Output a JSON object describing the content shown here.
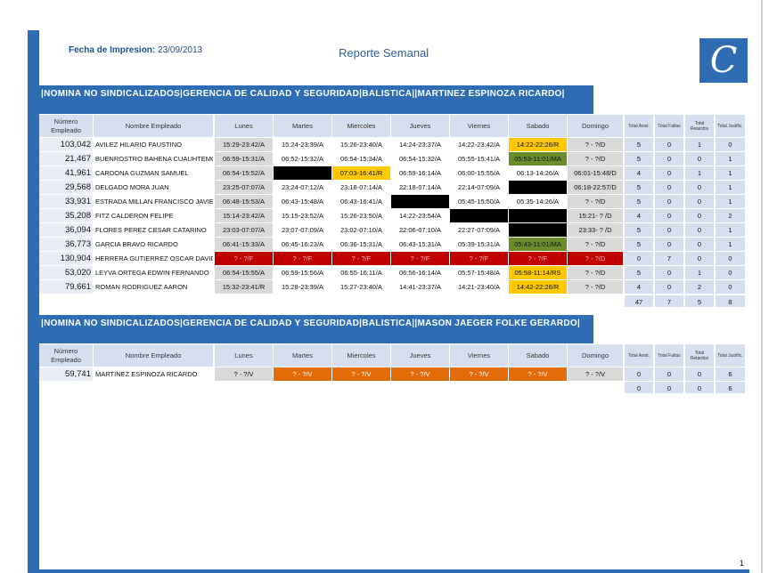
{
  "print_label": "Fecha de Impresion:",
  "print_date": "23/09/2013",
  "report_title": "Reporte Semanal",
  "logo_letter": "C",
  "page_number": "1",
  "columns": {
    "num": "Número Empleado",
    "name": "Nombre Empleado",
    "days": [
      "Lunes",
      "Martes",
      "Miercoles",
      "Jueves",
      "Viernes",
      "Sabado",
      "Domingo"
    ],
    "totals": [
      "Total Asist.",
      "Total Faltas",
      "Total Retardos",
      "Total Justific."
    ]
  },
  "colors": {
    "blue": "#2e6db4",
    "yellow": "#ffc800",
    "green": "#6a8c2a",
    "red": "#c00000",
    "orange": "#e36c09",
    "black": "#000000",
    "gray": "#d9d9d9"
  },
  "sections": [
    {
      "header": "|NOMINA NO SINDICALIZADOS|GERENCIA DE CALIDAD Y SEGURIDAD|BALISTICA||MARTINEZ ESPINOZA RICARDO|",
      "rows": [
        {
          "num": "103,042",
          "name": "AVILEZ HILARIO FAUSTINO",
          "days": [
            [
              "15:29-23:42/A",
              "gray"
            ],
            [
              "15:24-23:39/A",
              "w"
            ],
            [
              "15:26-23:40/A",
              "w"
            ],
            [
              "14:24-23:37/A",
              "w"
            ],
            [
              "14:22-23:42/A",
              "w"
            ],
            [
              "14:22-22:26/R",
              "yellow"
            ],
            [
              "? - ?/D",
              "gray"
            ]
          ],
          "totals": [
            "5",
            "0",
            "1",
            "0"
          ]
        },
        {
          "num": "21,467",
          "name": "BUENROSTRO BAHENA CUAUHTEMO",
          "days": [
            [
              "06:59-15:31/A",
              "gray"
            ],
            [
              "06:52-15:32/A",
              "w"
            ],
            [
              "06:54-15:34/A",
              "w"
            ],
            [
              "06:54-15:32/A",
              "w"
            ],
            [
              "05:55-15:41/A",
              "w"
            ],
            [
              "05:53-11:01/MA",
              "green"
            ],
            [
              "? - ?/D",
              "gray"
            ]
          ],
          "totals": [
            "5",
            "0",
            "0",
            "1"
          ]
        },
        {
          "num": "41,961",
          "name": "CARDONA GUZMAN SAMUEL",
          "days": [
            [
              "06:54-15:52/A",
              "gray"
            ],
            [
              "",
              "black"
            ],
            [
              "07:03-16:41/R",
              "yellow"
            ],
            [
              "06:59-16:14/A",
              "w"
            ],
            [
              "06:00-15:55/A",
              "w"
            ],
            [
              "06:13-14:26/A",
              "w"
            ],
            [
              "06:01-15:48/D",
              "gray"
            ]
          ],
          "totals": [
            "4",
            "0",
            "1",
            "1"
          ]
        },
        {
          "num": "29,568",
          "name": "DELGADO MORA JUAN",
          "days": [
            [
              "23:25-07:07/A",
              "gray"
            ],
            [
              "23:24-07:12/A",
              "w"
            ],
            [
              "23:18-07:14/A",
              "w"
            ],
            [
              "22:18-07:14/A",
              "w"
            ],
            [
              "22:14-07:09/A",
              "w"
            ],
            [
              "",
              "black"
            ],
            [
              "06:18-22:57/D",
              "gray"
            ]
          ],
          "totals": [
            "5",
            "0",
            "0",
            "1"
          ]
        },
        {
          "num": "33,931",
          "name": "ESTRADA MILLAN FRANCISCO JAVIE",
          "days": [
            [
              "06:48-15:53/A",
              "gray"
            ],
            [
              "06:43-15:48/A",
              "w"
            ],
            [
              "06:43-16:41/A",
              "w"
            ],
            [
              "",
              "black"
            ],
            [
              "05:45-15:50/A",
              "w"
            ],
            [
              "05:35-14:26/A",
              "w"
            ],
            [
              "? - ?/D",
              "gray"
            ]
          ],
          "totals": [
            "5",
            "0",
            "0",
            "1"
          ]
        },
        {
          "num": "35,208",
          "name": "FITZ CALDERON FELIPE",
          "days": [
            [
              "15:14-23:42/A",
              "gray"
            ],
            [
              "15:15-23:52/A",
              "w"
            ],
            [
              "15:26-23:50/A",
              "w"
            ],
            [
              "14:22-23:54/A",
              "w"
            ],
            [
              "",
              "black"
            ],
            [
              "",
              "black"
            ],
            [
              "15:21- ? /D",
              "gray"
            ]
          ],
          "totals": [
            "4",
            "0",
            "0",
            "2"
          ]
        },
        {
          "num": "36,094",
          "name": "FLORES PEREZ CESAR CATARINO",
          "days": [
            [
              "23:03-07:07/A",
              "gray"
            ],
            [
              "23:07-07:09/A",
              "w"
            ],
            [
              "23:02-07:10/A",
              "w"
            ],
            [
              "22:06-07:10/A",
              "w"
            ],
            [
              "22:27-07:09/A",
              "w"
            ],
            [
              "",
              "black"
            ],
            [
              "23:33- ? /D",
              "gray"
            ]
          ],
          "totals": [
            "5",
            "0",
            "0",
            "1"
          ]
        },
        {
          "num": "36,773",
          "name": "GARCIA BRAVO RICARDO",
          "days": [
            [
              "06:41-15:33/A",
              "gray"
            ],
            [
              "06:45-16:23/A",
              "w"
            ],
            [
              "06:36-15:31/A",
              "w"
            ],
            [
              "06:43-15:31/A",
              "w"
            ],
            [
              "05:39-15:31/A",
              "w"
            ],
            [
              "05:43-11:01/MA",
              "green"
            ],
            [
              "? - ?/D",
              "gray"
            ]
          ],
          "totals": [
            "5",
            "0",
            "0",
            "1"
          ]
        },
        {
          "num": "130,904",
          "name": "HERRERA GUTIERREZ OSCAR DAVID",
          "days": [
            [
              "? - ?/F",
              "red"
            ],
            [
              "? - ?/F",
              "red"
            ],
            [
              "? - ?/F",
              "red"
            ],
            [
              "? - ?/F",
              "red"
            ],
            [
              "? - ?/F",
              "red"
            ],
            [
              "? - ?/F",
              "red"
            ],
            [
              "? - ?/D",
              "red"
            ]
          ],
          "totals": [
            "0",
            "7",
            "0",
            "0"
          ]
        },
        {
          "num": "53,020",
          "name": "LEYVA ORTEGA EDWIN FERNANDO",
          "days": [
            [
              "06:54-15:55/A",
              "gray"
            ],
            [
              "06:59-15:56/A",
              "w"
            ],
            [
              "06:55-16:11/A",
              "w"
            ],
            [
              "06:56-16:14/A",
              "w"
            ],
            [
              "05:57-15:48/A",
              "w"
            ],
            [
              "05:58-11:14/RS",
              "yellow"
            ],
            [
              "? - ?/D",
              "gray"
            ]
          ],
          "totals": [
            "5",
            "0",
            "1",
            "0"
          ]
        },
        {
          "num": "79,661",
          "name": "ROMAN RODRIGUEZ AARON",
          "days": [
            [
              "15:32-23:41/R",
              "gray"
            ],
            [
              "15:28-23:39/A",
              "w"
            ],
            [
              "15:27-23:40/A",
              "w"
            ],
            [
              "14:41-23:37/A",
              "w"
            ],
            [
              "14:21-23:40/A",
              "w"
            ],
            [
              "14:42-22:26/R",
              "yellow"
            ],
            [
              "? - ?/D",
              "gray"
            ]
          ],
          "totals": [
            "4",
            "0",
            "2",
            "0"
          ]
        }
      ],
      "summary": [
        "47",
        "7",
        "5",
        "8"
      ]
    },
    {
      "header": "|NOMINA NO SINDICALIZADOS|GERENCIA DE CALIDAD Y SEGURIDAD|BALISTICA||MASON JAEGER FOLKE GERARDO|",
      "rows": [
        {
          "num": "59,741",
          "name": "MARTINEZ ESPINOZA RICARDO",
          "days": [
            [
              "? - ?/V",
              "gray"
            ],
            [
              "? - ?/V",
              "orange"
            ],
            [
              "? - ?/V",
              "orange"
            ],
            [
              "? - ?/V",
              "orange"
            ],
            [
              "? - ?/V",
              "orange"
            ],
            [
              "? - ?/V",
              "orange"
            ],
            [
              "? - ?/V",
              "gray"
            ]
          ],
          "totals": [
            "0",
            "0",
            "0",
            "6"
          ]
        }
      ],
      "summary": [
        "0",
        "0",
        "0",
        "6"
      ]
    }
  ]
}
